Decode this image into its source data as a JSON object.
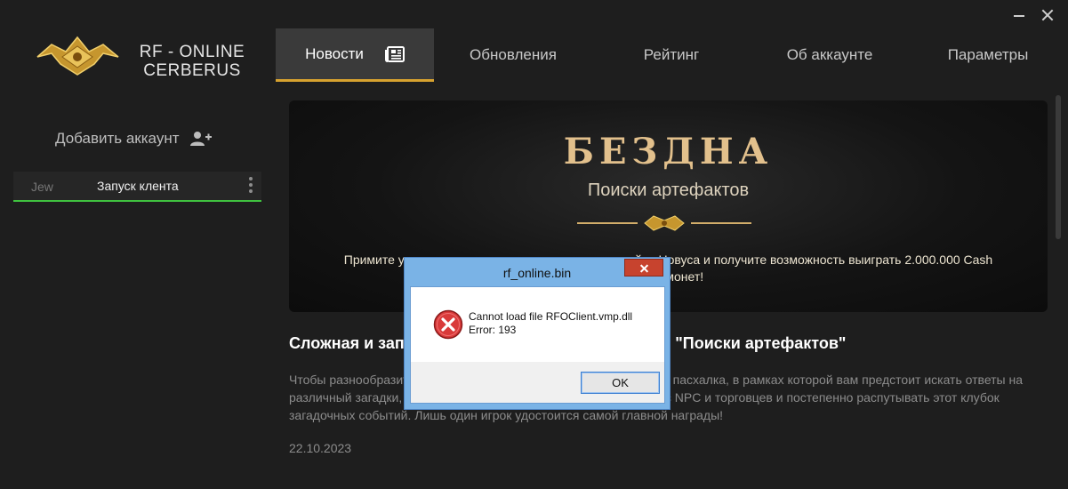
{
  "app": {
    "brand_line1": "RF - ONLINE",
    "brand_line2": "CERBERUS"
  },
  "window_controls": {
    "minimize_icon": "minimize-icon",
    "close_icon": "close-icon"
  },
  "sidebar": {
    "add_account_label": "Добавить аккаунт",
    "add_account_icon": "add-user-icon",
    "accounts": [
      {
        "nick": "Jew",
        "launch_label": "Запуск клента",
        "active_color": "#3fc23f"
      }
    ]
  },
  "tabs": [
    {
      "label": "Новости",
      "active": true,
      "icon": "newspaper-icon"
    },
    {
      "label": "Обновления",
      "active": false
    },
    {
      "label": "Рейтинг",
      "active": false
    },
    {
      "label": "Об аккаунте",
      "active": false
    },
    {
      "label": "Параметры",
      "active": false
    }
  ],
  "accent_color": "#d7a22f",
  "news": {
    "banner_title": "БЕЗДНА",
    "banner_subtitle": "Поиски артефактов",
    "banner_text": "Примите участие в поисках ответов на главную тайну Новуса и получите возможность выиграть 2.000.000 Cash Shop монет!",
    "article_title": "Сложная и запутанная история под названием - \"Поиски артефактов\"",
    "article_body": "Чтобы разнообразить ваши будни мы подготовили для вас новую пасхалка, в рамках которой вам предстоит искать ответы на различный загадки, выполнять поручения старейшин, общаться с NPC и торговцев и постепенно распутывать этот клубок загадочных событий. Лишь один игрок удостоится самой главной награды!",
    "article_date": "22.10.2023"
  },
  "dialog": {
    "title": "rf_online.bin",
    "message_line1": "Cannot load file RFOClient.vmp.dll",
    "message_line2": "Error: 193",
    "ok_label": "OK",
    "icon": "error-icon"
  }
}
